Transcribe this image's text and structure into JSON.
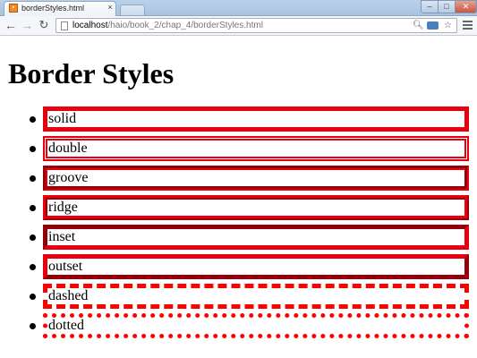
{
  "browser": {
    "tab_title": "borderStyles.html",
    "tab_close": "×",
    "url_host": "localhost",
    "url_path": "/haio/book_2/chap_4/borderStyles.html",
    "icons": [
      "back-arrow-icon",
      "forward-arrow-icon",
      "reload-icon",
      "page-icon",
      "zoom-icon",
      "extension-icon",
      "star-icon",
      "menu-icon"
    ]
  },
  "page": {
    "heading": "Border Styles",
    "border_color": "#e8000f",
    "items": [
      {
        "label": "solid",
        "style": "solid"
      },
      {
        "label": "double",
        "style": "double"
      },
      {
        "label": "groove",
        "style": "groove"
      },
      {
        "label": "ridge",
        "style": "ridge"
      },
      {
        "label": "inset",
        "style": "inset"
      },
      {
        "label": "outset",
        "style": "outset"
      },
      {
        "label": "dashed",
        "style": "dashed"
      },
      {
        "label": "dotted",
        "style": "dotted"
      }
    ]
  }
}
